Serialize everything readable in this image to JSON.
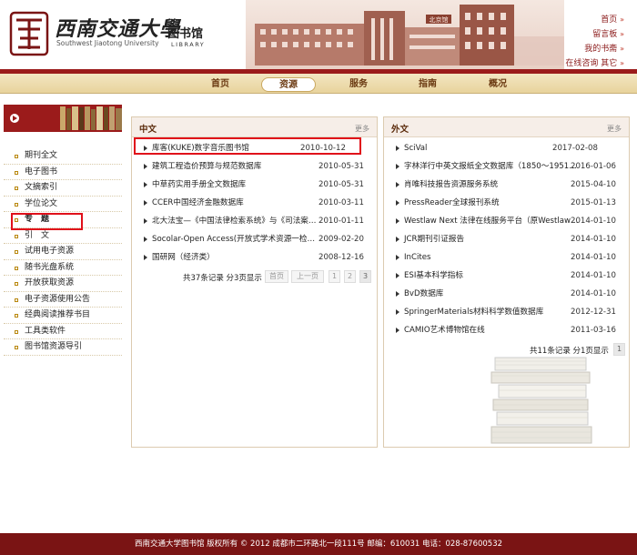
{
  "header": {
    "logo_cn": "西南交通大學",
    "logo_en": "Southwest Jiaotong University",
    "library_cn": "图书馆",
    "library_en": "LIBRARY",
    "building_sign": "北京馆",
    "toplinks": [
      {
        "label": "首页",
        "arrow": "»"
      },
      {
        "label": "留言板",
        "arrow": "»"
      },
      {
        "label": "我的书斋",
        "arrow": "»"
      },
      {
        "label": "在线咨询 其它",
        "arrow": "»"
      }
    ]
  },
  "nav": {
    "items": [
      "首页",
      "资源",
      "服务",
      "指南",
      "概况"
    ],
    "active": "资源"
  },
  "sidebar": {
    "items": [
      "期刊全文",
      "电子图书",
      "文摘索引",
      "学位论文",
      "专　题",
      "引　文",
      "试用电子资源",
      "随书光盘系统",
      "开放获取资源",
      "电子资源使用公告",
      "经典阅读推荐书目",
      "工具类软件",
      "图书馆资源导引"
    ],
    "highlighted": "专　题"
  },
  "chinese_panel": {
    "title": "中文",
    "more": "更多",
    "rows": [
      {
        "title": "库客(KUKE)数字音乐图书馆",
        "date": "2010-10-12"
      },
      {
        "title": "建筑工程造价预算与规范数据库",
        "date": "2010-05-31"
      },
      {
        "title": "中草药实用手册全文数据库",
        "date": "2010-05-31"
      },
      {
        "title": "CCER中国经济金融数据库",
        "date": "2010-03-11"
      },
      {
        "title": "北大法宝—《中国法律检索系统》与《司法案…",
        "date": "2010-01-11"
      },
      {
        "title": "Socolar-Open Access(开放式学术资源一检…",
        "date": "2009-02-20"
      },
      {
        "title": "国研网（经济类）",
        "date": "2008-12-16"
      }
    ],
    "pager": {
      "summary": "共37条记录 分3页显示",
      "first": "首页",
      "prev": "上一页",
      "pages": [
        "1",
        "2",
        "3"
      ]
    }
  },
  "foreign_panel": {
    "title": "外文",
    "more": "更多",
    "rows": [
      {
        "title": "SciVal",
        "date": "2017-02-08"
      },
      {
        "title": "字林洋行中英文报纸全文数据库（1850～1951…",
        "date": "2016-01-06"
      },
      {
        "title": "肖唯科技报告资源服务系统",
        "date": "2015-04-10"
      },
      {
        "title": "PressReader全球报刊系统",
        "date": "2015-01-13"
      },
      {
        "title": "Westlaw Next 法律在线服务平台（原Westlaw…",
        "date": "2014-01-10"
      },
      {
        "title": "JCR期刊引证报告",
        "date": "2014-01-10"
      },
      {
        "title": "InCites",
        "date": "2014-01-10"
      },
      {
        "title": "ESI基本科学指标",
        "date": "2014-01-10"
      },
      {
        "title": "BvD数据库",
        "date": "2014-01-10"
      },
      {
        "title": "SpringerMaterials材料科学数值数据库",
        "date": "2012-12-31"
      },
      {
        "title": "CAMIO艺术博物馆在线",
        "date": "2011-03-16"
      }
    ],
    "pager": {
      "summary": "共11条记录 分1页显示",
      "pages": [
        "1"
      ]
    }
  },
  "footer": {
    "text": "西南交通大学图书馆  版权所有  ©  2012  成都市二环路北一段111号  邮编：610031  电话：028-87600532"
  },
  "colors": {
    "brand_red": "#9b1b1b",
    "footer_red": "#7a1414",
    "nav_gold": "#e8d39c",
    "highlight_box": "#e0101a"
  }
}
